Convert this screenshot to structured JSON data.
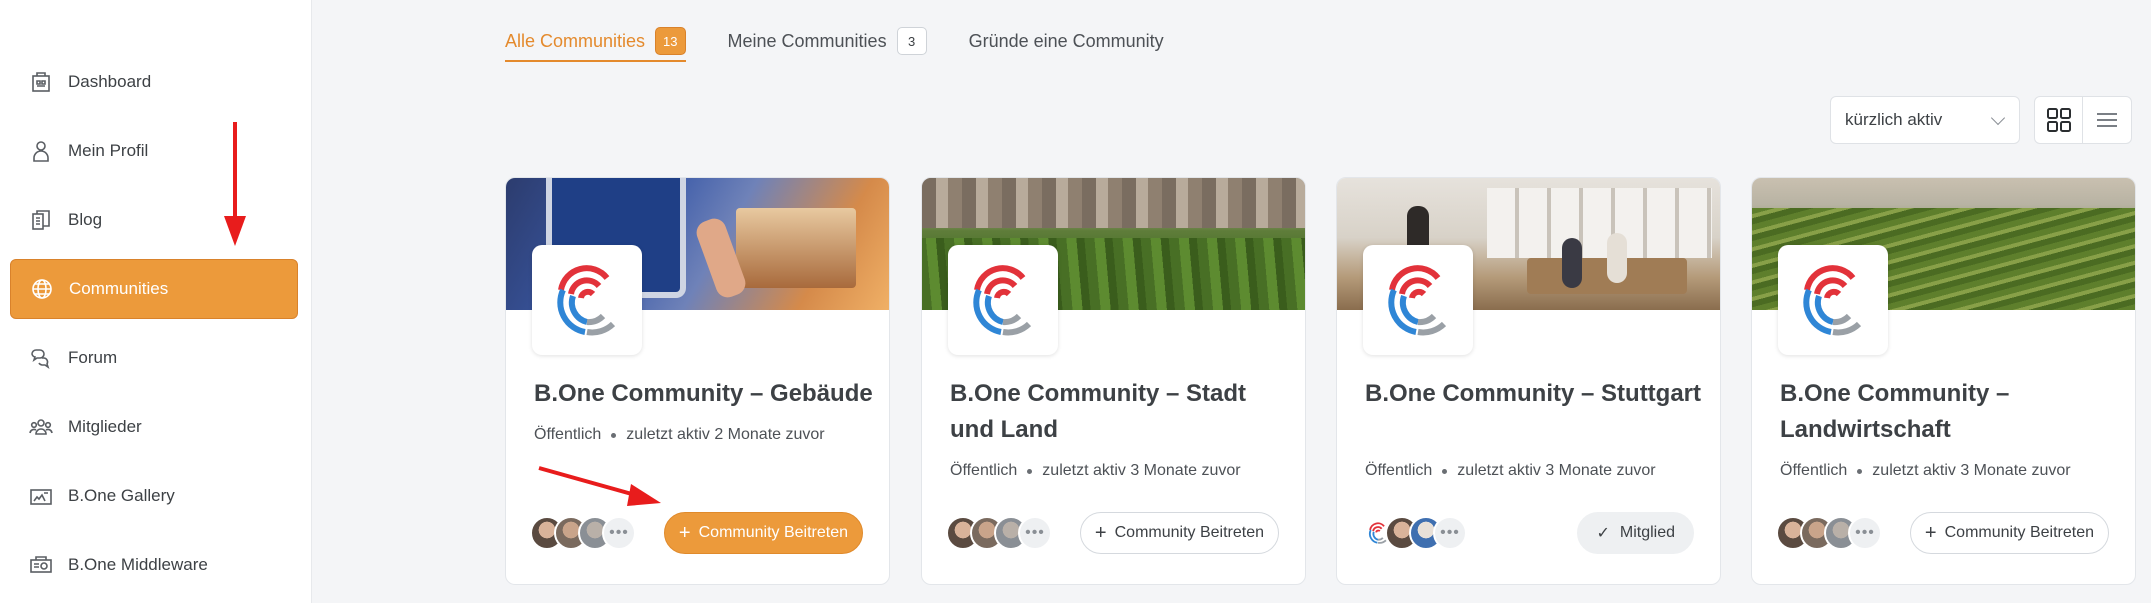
{
  "sidebar": {
    "items": [
      {
        "label": "Dashboard",
        "icon": "dashboard-icon",
        "active": false
      },
      {
        "label": "Mein Profil",
        "icon": "user-icon",
        "active": false
      },
      {
        "label": "Blog",
        "icon": "blog-icon",
        "active": false
      },
      {
        "label": "Communities",
        "icon": "globe-icon",
        "active": true
      },
      {
        "label": "Forum",
        "icon": "chat-icon",
        "active": false
      },
      {
        "label": "Mitglieder",
        "icon": "members-icon",
        "active": false
      },
      {
        "label": "B.One Gallery",
        "icon": "gallery-icon",
        "active": false
      },
      {
        "label": "B.One Middleware",
        "icon": "middleware-icon",
        "active": false
      }
    ]
  },
  "tabs": [
    {
      "label": "Alle Communities",
      "count": "13",
      "active": true
    },
    {
      "label": "Meine Communities",
      "count": "3",
      "active": false
    },
    {
      "label": "Gründe eine Community",
      "count": null,
      "active": false
    }
  ],
  "sort": {
    "selected": "kürzlich aktiv"
  },
  "view": {
    "grid_icon": "grid-icon",
    "list_icon": "list-icon"
  },
  "colors": {
    "accent": "#ec9a3b",
    "logo_red": "#e2323a",
    "logo_blue": "#2f86d6",
    "logo_gray": "#9aa0a6"
  },
  "cards": [
    {
      "title": "B.One Community – Gebäude",
      "visibility": "Öffentlich",
      "activity": "zuletzt aktiv 2 Monate zuvor",
      "more": "•••",
      "button": "Community Beitreten",
      "button_type": "primary"
    },
    {
      "title": "B.One Community – Stadt und Land",
      "visibility": "Öffentlich",
      "activity": "zuletzt aktiv 3 Monate zuvor",
      "more": "•••",
      "button": "Community Beitreten",
      "button_type": "outline"
    },
    {
      "title": "B.One Community – Stuttgart",
      "visibility": "Öffentlich",
      "activity": "zuletzt aktiv 3 Monate zuvor",
      "more": "•••",
      "button": "Mitglied",
      "button_type": "member"
    },
    {
      "title": "B.One Community – Landwirtschaft",
      "visibility": "Öffentlich",
      "activity": "zuletzt aktiv 3 Monate zuvor",
      "more": "•••",
      "button": "Community Beitreten",
      "button_type": "outline"
    }
  ]
}
